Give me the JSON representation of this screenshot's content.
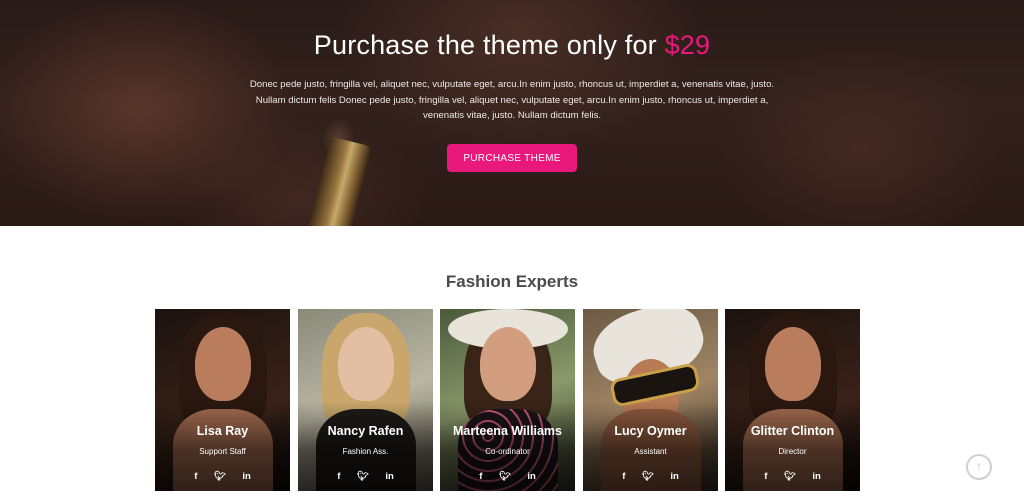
{
  "hero": {
    "title_prefix": "Purchase the theme only for",
    "price": "$29",
    "description": "Donec pede justo, fringilla vel, aliquet nec, vulputate eget, arcu.In enim justo, rhoncus ut, imperdiet a, venenatis vitae, justo. Nullam dictum felis Donec pede justo, fringilla vel, aliquet nec, vulputate eget, arcu.In enim justo, rhoncus ut, imperdiet a, venenatis vitae, justo. Nullam dictum felis.",
    "cta_label": "PURCHASE THEME",
    "accent_color": "#e8187c"
  },
  "experts": {
    "title": "Fashion Experts",
    "members": [
      {
        "name": "Lisa Ray",
        "role": "Support Staff",
        "socials": [
          "f",
          "t",
          "in"
        ]
      },
      {
        "name": "Nancy Rafen",
        "role": "Fashion Ass.",
        "socials": [
          "f",
          "t",
          "in"
        ]
      },
      {
        "name": "Marteena Williams",
        "role": "Co-ordinator",
        "socials": [
          "f",
          "t",
          "in"
        ]
      },
      {
        "name": "Lucy Oymer",
        "role": "Assistant",
        "socials": [
          "f",
          "t",
          "in"
        ]
      },
      {
        "name": "Glitter Clinton",
        "role": "Director",
        "socials": [
          "f",
          "t",
          "in"
        ]
      }
    ]
  },
  "icons": {
    "facebook": "facebook-icon",
    "twitter": "twitter-icon",
    "linkedin": "linkedin-icon",
    "scroll_top": "arrow-up-circle-icon"
  }
}
